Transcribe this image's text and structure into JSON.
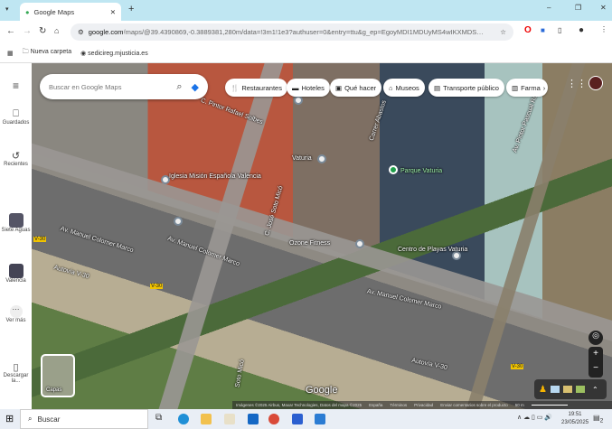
{
  "browser": {
    "tab_title": "Google Maps",
    "url_host": "google.com",
    "url_path": "/maps/@39.4390869,-0.3889381,280m/data=!3m1!1e3?authuser=0&entry=ttu&g_ep=EgoyMDI1MDUyMS4wIKXMDSoASA...",
    "bookmarks": [
      "Nueva carpeta",
      "sedicireg.mjusticia.es"
    ]
  },
  "sidebar": {
    "items": [
      {
        "label": "Guardados"
      },
      {
        "label": "Recientes"
      },
      {
        "label": "Siete Aguas"
      },
      {
        "label": "Valencia"
      },
      {
        "label": "Ver más"
      },
      {
        "label": "Descargar la..."
      }
    ]
  },
  "search": {
    "placeholder": "Buscar en Google Maps"
  },
  "chips": [
    "Restaurantes",
    "Hoteles",
    "Qué hacer",
    "Museos",
    "Transporte público",
    "Farma"
  ],
  "map": {
    "labels": [
      "C. Pintor Rafael Solbes",
      "Iglesia Misión Española Valencia",
      "Vaturia",
      "Parque Vaturia",
      "Carrer Abastos",
      "Av. Manuel Colomer Marco",
      "Av. Manuel Colomer Marco",
      "Av. Manuel Colomer Marco",
      "C. José Soto Micó",
      "Soto Micó",
      "Autovía V-30",
      "Autovía V-30",
      "Av. Pintor Pascual Roch",
      "Ozone Fitness",
      "Centro de Playas Vaturia",
      "V-30",
      "V-30",
      "V-30"
    ],
    "layers_label": "Capas",
    "logo": "Google",
    "attribution": "Imágenes ©2025 Airbus, Maxar Technologies, Datos del mapa ©2025",
    "footer_links": [
      "España",
      "Términos",
      "Privacidad",
      "Enviar comentarios sobre el producto"
    ],
    "scale": "50 m"
  },
  "taskbar": {
    "search_placeholder": "Buscar",
    "time": "19:51",
    "date": "23/05/2025",
    "notif_count": "2"
  }
}
